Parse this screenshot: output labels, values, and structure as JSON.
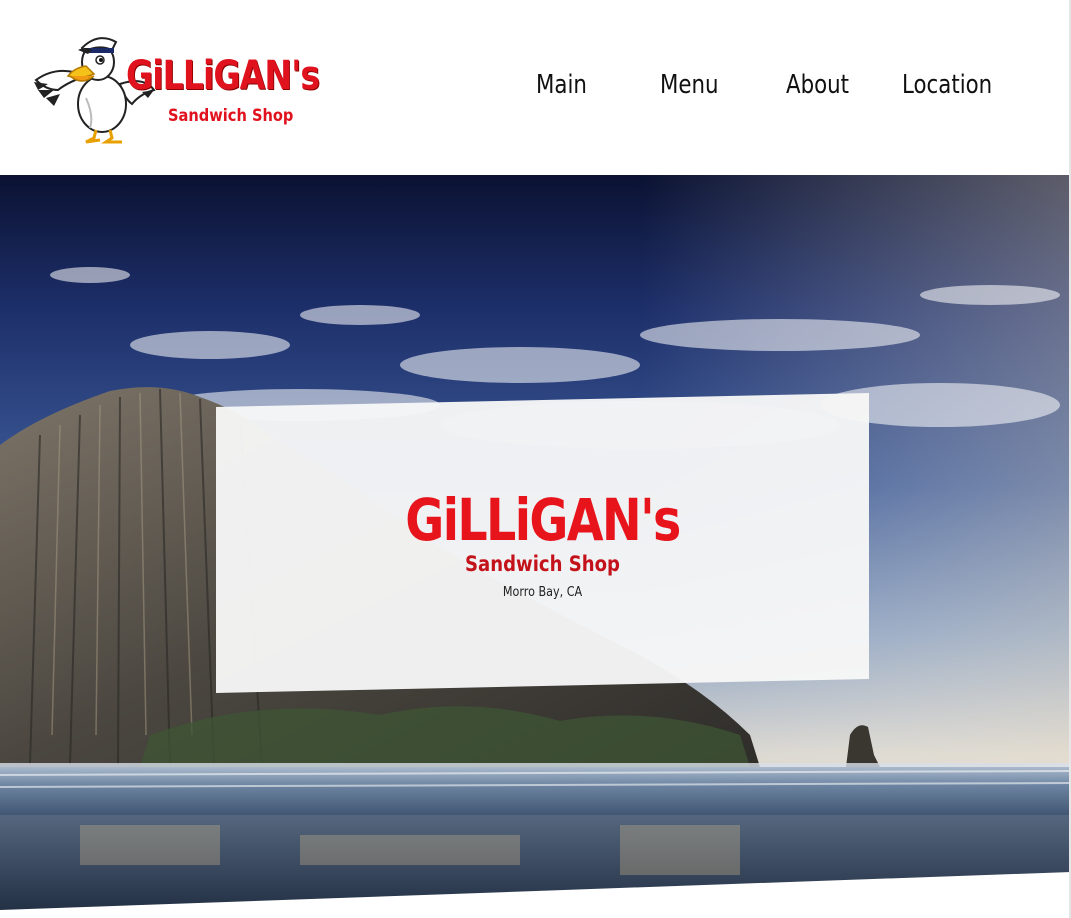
{
  "header": {
    "logo": {
      "brand_name": "GiLLiGAN's",
      "tagline": "Sandwich Shop",
      "mascot_icon": "pelican-mascot-icon"
    },
    "nav": {
      "items": [
        {
          "label": "Main"
        },
        {
          "label": "Menu"
        },
        {
          "label": "About"
        },
        {
          "label": "Location"
        }
      ]
    }
  },
  "hero": {
    "background": "morro-rock-beach-photo",
    "card": {
      "title": "GiLLiGAN's",
      "subtitle": "Sandwich Shop",
      "location": "Morro Bay, CA"
    }
  },
  "colors": {
    "brand_red": "#e8141c",
    "nav_text": "#111111",
    "card_bg": "#f7f7f7"
  }
}
